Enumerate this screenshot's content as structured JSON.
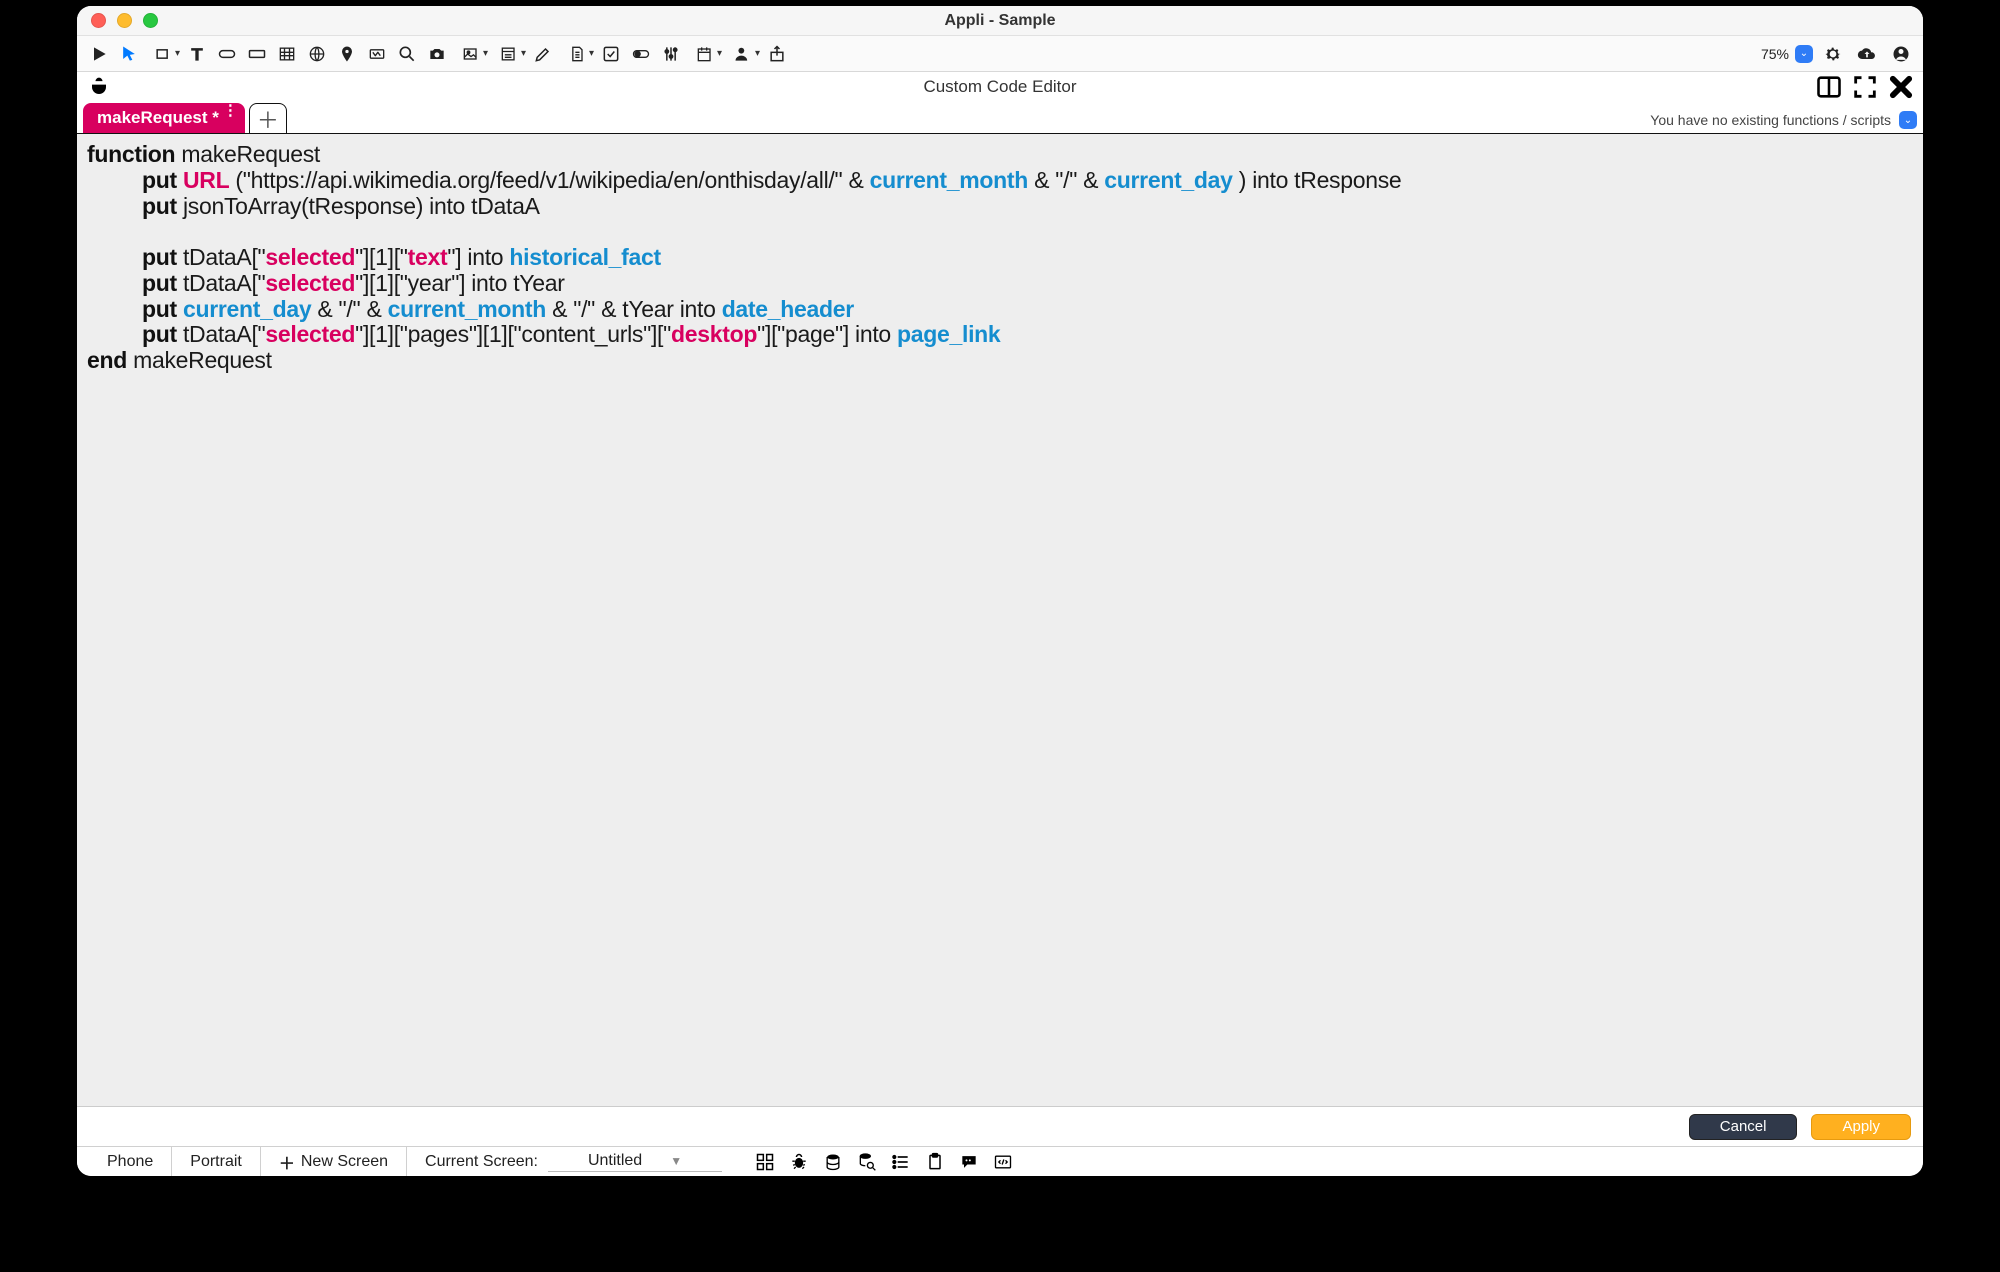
{
  "window": {
    "title": "Appli - Sample"
  },
  "mainToolbar": {
    "zoom": "75%"
  },
  "editor": {
    "title": "Custom Code Editor",
    "tabLabel": "makeRequest *",
    "functionsStatus": "You have no existing functions / scripts"
  },
  "code": {
    "tokens": [
      [
        {
          "t": "function",
          "c": "kw"
        },
        {
          "t": " makeRequest"
        }
      ],
      [
        {
          "indent": 1
        },
        {
          "t": "put ",
          "c": "kw"
        },
        {
          "t": "URL",
          "c": "pink"
        },
        {
          "t": " (\"https://api.wikimedia.org/feed/v1/wikipedia/en/onthisday/all/\" & "
        },
        {
          "t": "current_month",
          "c": "blue"
        },
        {
          "t": " & \"/\" & "
        },
        {
          "t": "current_day",
          "c": "blue"
        },
        {
          "t": " ) into tResponse"
        }
      ],
      [
        {
          "indent": 1
        },
        {
          "t": "put ",
          "c": "kw"
        },
        {
          "t": "jsonToArray(tResponse) into tDataA"
        }
      ],
      [],
      [
        {
          "indent": 1
        },
        {
          "t": "put ",
          "c": "kw"
        },
        {
          "t": "tDataA[\""
        },
        {
          "t": "selected",
          "c": "pink"
        },
        {
          "t": "\"][1][\""
        },
        {
          "t": "text",
          "c": "pink"
        },
        {
          "t": "\"] into "
        },
        {
          "t": "historical_fact",
          "c": "blue"
        }
      ],
      [
        {
          "indent": 1
        },
        {
          "t": "put ",
          "c": "kw"
        },
        {
          "t": "tDataA[\""
        },
        {
          "t": "selected",
          "c": "pink"
        },
        {
          "t": "\"][1][\"year\"] into tYear"
        }
      ],
      [
        {
          "indent": 1
        },
        {
          "t": "put ",
          "c": "kw"
        },
        {
          "t": "current_day",
          "c": "blue"
        },
        {
          "t": " & \"/\" & "
        },
        {
          "t": "current_month",
          "c": "blue"
        },
        {
          "t": " & \"/\" & tYear into "
        },
        {
          "t": "date_header",
          "c": "blue"
        }
      ],
      [
        {
          "indent": 1
        },
        {
          "t": "put ",
          "c": "kw"
        },
        {
          "t": "tDataA[\""
        },
        {
          "t": "selected",
          "c": "pink"
        },
        {
          "t": "\"][1][\"pages\"][1][\"content_urls\"][\""
        },
        {
          "t": "desktop",
          "c": "pink"
        },
        {
          "t": "\"][\"page\"] into "
        },
        {
          "t": "page_link",
          "c": "blue"
        }
      ],
      [
        {
          "t": "end",
          "c": "kw"
        },
        {
          "t": " makeRequest"
        }
      ]
    ]
  },
  "buttons": {
    "cancel": "Cancel",
    "apply": "Apply"
  },
  "status": {
    "device": "Phone",
    "orientation": "Portrait",
    "newScreen": "New Screen",
    "currentScreenLabel": "Current Screen:",
    "currentScreenValue": "Untitled"
  }
}
